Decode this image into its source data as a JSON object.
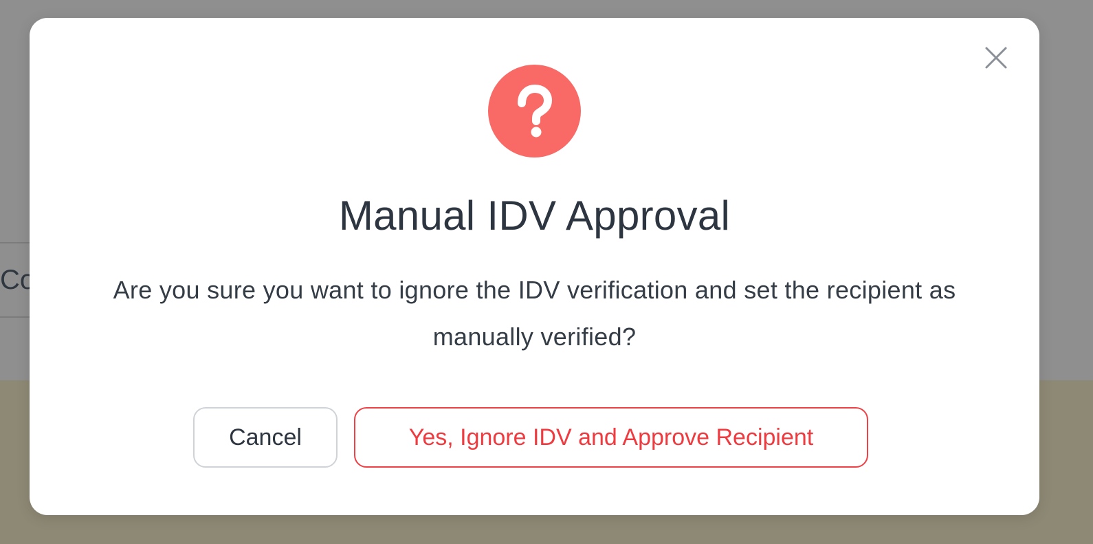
{
  "background": {
    "row_text_fragment": "Co"
  },
  "modal": {
    "icon": "question-mark-icon",
    "close_icon": "close-icon",
    "title": "Manual IDV Approval",
    "message": "Are you sure you want to ignore the IDV verification and set the recipient as manually verified?",
    "cancel_label": "Cancel",
    "confirm_label": "Yes, Ignore IDV and Approve Recipient"
  },
  "colors": {
    "accent_danger": "#ef4045",
    "icon_bg": "#f96965",
    "overlay": "#8f8f8f"
  }
}
